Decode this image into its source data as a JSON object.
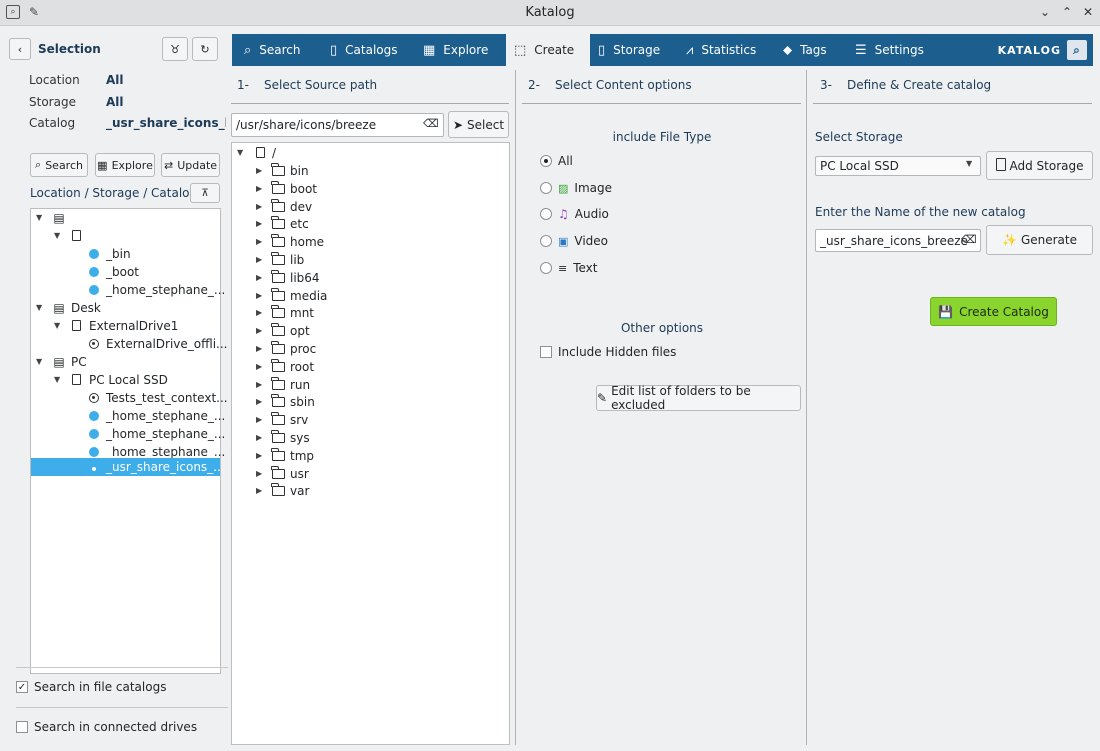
{
  "window": {
    "title": "Katalog",
    "app_icon": "katalog-app-icon",
    "pin_icon": "pin-icon",
    "controls": {
      "minimize": "⌄",
      "maximize": "⌃",
      "close": "✕"
    }
  },
  "left": {
    "selection_label": "Selection",
    "back_icon": "chevron-left-icon",
    "filters": [
      {
        "label": "Location",
        "value": "All"
      },
      {
        "label": "Storage",
        "value": "All"
      },
      {
        "label": "Catalog",
        "value": "_usr_share_icons_bre"
      }
    ],
    "buttons": {
      "search": "Search",
      "explore": "Explore",
      "update": "Update"
    },
    "tree_header": "Location / Storage / Catalog",
    "tree": [
      {
        "label": "",
        "kind": "location",
        "expanded": true
      },
      {
        "label": "",
        "kind": "drive",
        "expanded": true
      },
      {
        "label": "_bin",
        "kind": "catalog"
      },
      {
        "label": "_boot",
        "kind": "catalog"
      },
      {
        "label": "_home_stephane_...",
        "kind": "catalog"
      },
      {
        "label": "Desk",
        "kind": "location",
        "expanded": true
      },
      {
        "label": "ExternalDrive1",
        "kind": "drive",
        "expanded": true
      },
      {
        "label": "ExternalDrive_offli...",
        "kind": "catalog-offline"
      },
      {
        "label": "PC",
        "kind": "location",
        "expanded": true
      },
      {
        "label": "PC Local SSD",
        "kind": "drive",
        "expanded": true
      },
      {
        "label": "Tests_test_context...",
        "kind": "catalog-offline"
      },
      {
        "label": "_home_stephane_...",
        "kind": "catalog"
      },
      {
        "label": "_home_stephane_...",
        "kind": "catalog"
      },
      {
        "label": "_home_stephane_...",
        "kind": "catalog"
      },
      {
        "label": "_usr_share_icons_...",
        "kind": "catalog",
        "selected": true
      }
    ],
    "search_in_catalogs": {
      "label": "Search in file catalogs",
      "checked": true
    },
    "search_in_drives": {
      "label": "Search in connected drives",
      "checked": false
    }
  },
  "tabs": [
    {
      "label": "Search",
      "icon": "search-icon",
      "active": false
    },
    {
      "label": "Catalogs",
      "icon": "catalogs-icon",
      "active": false
    },
    {
      "label": "Explore",
      "icon": "explore-icon",
      "active": false
    },
    {
      "label": "Create",
      "icon": "create-icon",
      "active": true
    },
    {
      "label": "Storage",
      "icon": "storage-icon",
      "active": false
    },
    {
      "label": "Statistics",
      "icon": "statistics-icon",
      "active": false
    },
    {
      "label": "Tags",
      "icon": "tag-icon",
      "active": false
    },
    {
      "label": "Settings",
      "icon": "settings-icon",
      "active": false
    }
  ],
  "brand": "KATALOG",
  "col1": {
    "step": "1-",
    "heading": "Select Source path",
    "path": "/usr/share/icons/breeze",
    "select_label": "Select",
    "root": "/",
    "folders": [
      "bin",
      "boot",
      "dev",
      "etc",
      "home",
      "lib",
      "lib64",
      "media",
      "mnt",
      "opt",
      "proc",
      "root",
      "run",
      "sbin",
      "srv",
      "sys",
      "tmp",
      "usr",
      "var"
    ]
  },
  "col2": {
    "step": "2-",
    "heading": "Select Content options",
    "file_type_heading": "include File Type",
    "file_types": [
      {
        "label": "All",
        "checked": true,
        "icon": ""
      },
      {
        "label": "Image",
        "checked": false,
        "icon": "image-icon"
      },
      {
        "label": "Audio",
        "checked": false,
        "icon": "audio-icon"
      },
      {
        "label": "Video",
        "checked": false,
        "icon": "video-icon"
      },
      {
        "label": "Text",
        "checked": false,
        "icon": "text-icon"
      }
    ],
    "other_heading": "Other options",
    "include_hidden": {
      "label": "Include Hidden files",
      "checked": false
    },
    "edit_excluded_label": "Edit list of folders to be excluded"
  },
  "col3": {
    "step": "3-",
    "heading": "Define & Create catalog",
    "select_storage_label": "Select Storage",
    "storage_value": "PC Local SSD",
    "add_storage_label": "Add Storage",
    "name_label": "Enter the Name of the new catalog",
    "name_value": "_usr_share_icons_breeze",
    "generate_label": "Generate",
    "create_label": "Create Catalog"
  },
  "colors": {
    "tabbar": "#1c5f8f",
    "selection": "#3daee9",
    "create_button": "#8ad42e"
  }
}
